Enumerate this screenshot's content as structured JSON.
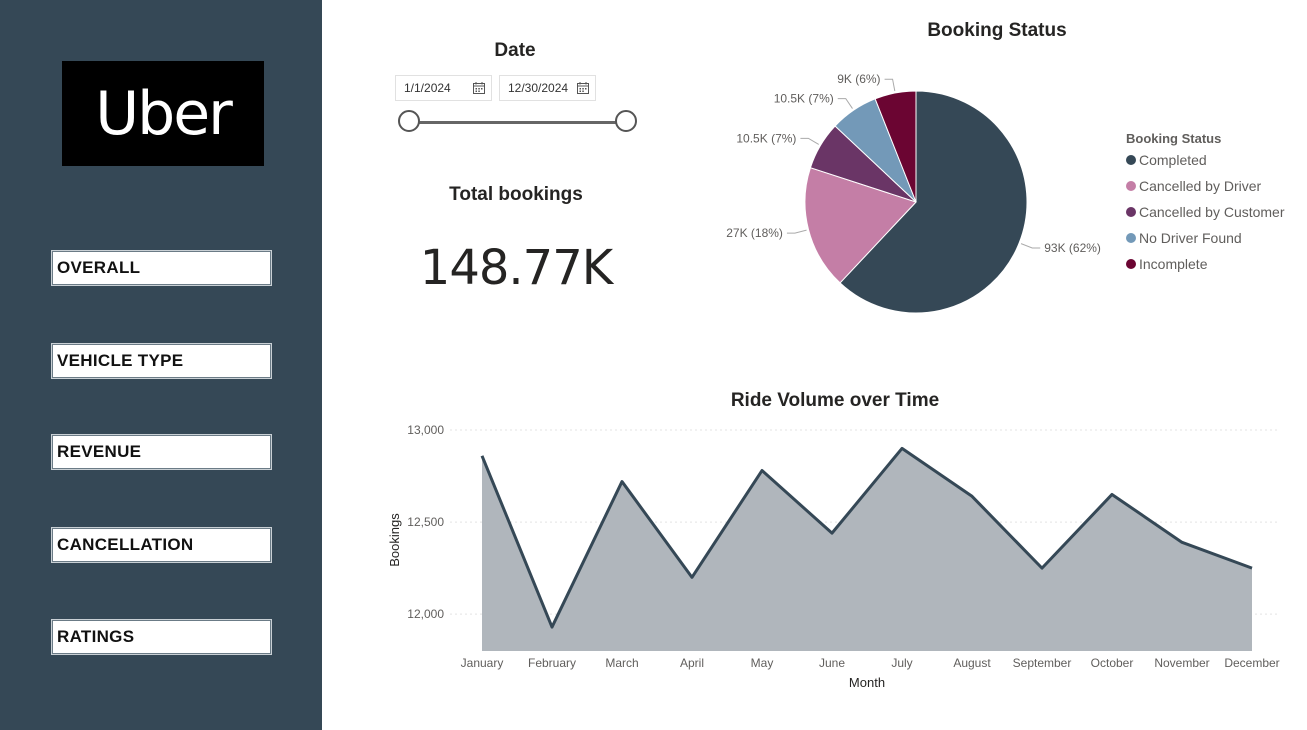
{
  "logo_text": "Uber",
  "nav": [
    {
      "label": "OVERALL"
    },
    {
      "label": "VEHICLE TYPE"
    },
    {
      "label": "REVENUE"
    },
    {
      "label": "CANCELLATION"
    },
    {
      "label": "RATINGS"
    }
  ],
  "date_filter": {
    "title": "Date",
    "start": "1/1/2024",
    "end": "12/30/2024"
  },
  "kpi": {
    "title": "Total bookings",
    "value": "148.77K"
  },
  "colors": {
    "sidebar": "#354856",
    "completed": "#354856",
    "cancelled_driver": "#c47ea6",
    "cancelled_customer": "#6a3566",
    "no_driver": "#7399b8",
    "incomplete": "#6b0532",
    "area_fill": "#b0b6bc"
  },
  "chart_data": [
    {
      "type": "pie",
      "title": "Booking Status",
      "legend_title": "Booking Status",
      "legend_position": "right",
      "slices": [
        {
          "name": "Completed",
          "value": 93000,
          "label": "93K (62%)",
          "color": "#354856"
        },
        {
          "name": "Cancelled by Driver",
          "value": 27000,
          "label": "27K (18%)",
          "color": "#c47ea6"
        },
        {
          "name": "Cancelled by Customer",
          "value": 10500,
          "label": "10.5K (7%)",
          "color": "#6a3566"
        },
        {
          "name": "No Driver Found",
          "value": 10500,
          "label": "10.5K (7%)",
          "color": "#7399b8"
        },
        {
          "name": "Incomplete",
          "value": 9000,
          "label": "9K (6%)",
          "color": "#6b0532"
        }
      ]
    },
    {
      "type": "area",
      "title": "Ride Volume over Time",
      "xlabel": "Month",
      "ylabel": "Bookings",
      "ylim": [
        11800,
        13000
      ],
      "yticks": [
        {
          "value": 12000,
          "label": "12,000"
        },
        {
          "value": 12500,
          "label": "12,500"
        },
        {
          "value": 13000,
          "label": "13,000"
        }
      ],
      "grid": true,
      "categories": [
        "January",
        "February",
        "March",
        "April",
        "May",
        "June",
        "July",
        "August",
        "September",
        "October",
        "November",
        "December"
      ],
      "values": [
        12860,
        11930,
        12720,
        12200,
        12780,
        12440,
        12900,
        12640,
        12250,
        12650,
        12390,
        12250
      ]
    }
  ]
}
